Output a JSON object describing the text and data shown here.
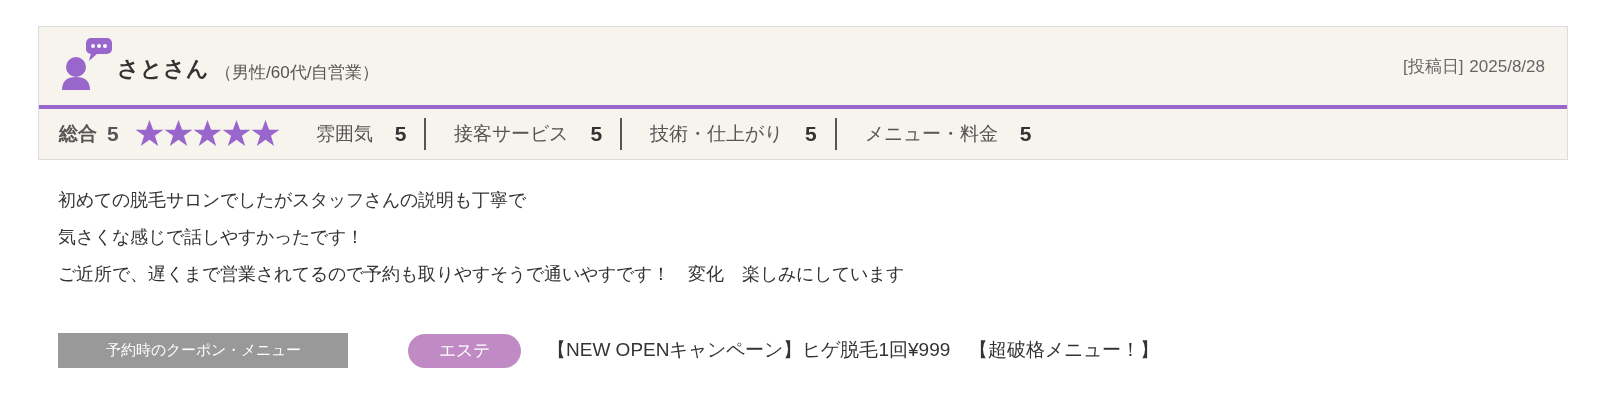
{
  "reviewer": {
    "name": "さとさん",
    "attributes": "（男性/60代/自営業）"
  },
  "post_date": {
    "label": "[投稿日]",
    "value": "2025/8/28"
  },
  "overall": {
    "label": "総合",
    "score": "5",
    "stars": 5
  },
  "categories": [
    {
      "label": "雰囲気",
      "score": "5"
    },
    {
      "label": "接客サービス",
      "score": "5"
    },
    {
      "label": "技術・仕上がり",
      "score": "5"
    },
    {
      "label": "メニュー・料金",
      "score": "5"
    }
  ],
  "comment_lines": [
    "初めての脱毛サロンでしたがスタッフさんの説明も丁寧で",
    "気さくな感じで話しやすかったです！",
    "ご近所で、遅くまで営業されてるので予約も取りやすそうで通いやすです！　変化　楽しみにしています"
  ],
  "coupon": {
    "label": "予約時のクーポン・メニュー",
    "tag": "エステ",
    "text": "【NEW OPENキャンペーン】ヒゲ脱毛1回¥999　【超破格メニュー！】"
  }
}
